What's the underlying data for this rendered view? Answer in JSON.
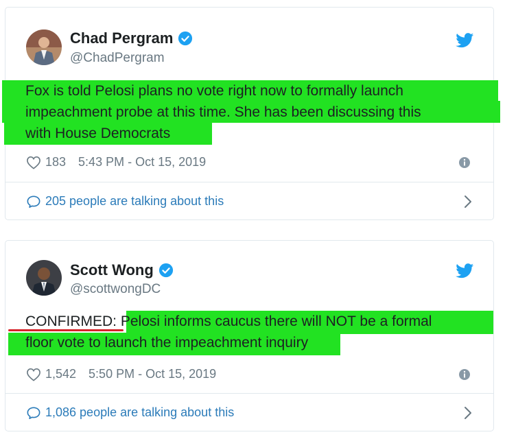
{
  "tweets": [
    {
      "author": "Chad Pergram",
      "handle": "@ChadPergram",
      "text_lines": [
        "Fox is told Pelosi plans no vote right now to formally launch",
        "impeachment probe at this time. She has been discussing this",
        "with House Democrats"
      ],
      "likes": "183",
      "timestamp": "5:43 PM - Oct 15, 2019",
      "talking": "205 people are talking about this"
    },
    {
      "author": "Scott Wong",
      "handle": "@scottwongDC",
      "text_prefix": "CONFIRMED",
      "text_colon": ":",
      "text_rest_line1": " Pelosi informs caucus there will NOT be a formal",
      "text_line2": "floor vote to launch the impeachment inquiry",
      "likes": "1,542",
      "timestamp": "5:50 PM - Oct 15, 2019",
      "talking": "1,086 people are talking about this"
    }
  ],
  "icons": {
    "verified": "verified-badge-icon",
    "bird": "twitter-bird-icon",
    "heart": "heart-icon",
    "info": "info-icon",
    "bubble": "speech-bubble-icon",
    "chevron": "chevron-right-icon"
  },
  "colors": {
    "highlight": "#22e222",
    "link": "#2b7bb9",
    "twitter_blue": "#1da1f2",
    "underline": "#d6232a"
  }
}
